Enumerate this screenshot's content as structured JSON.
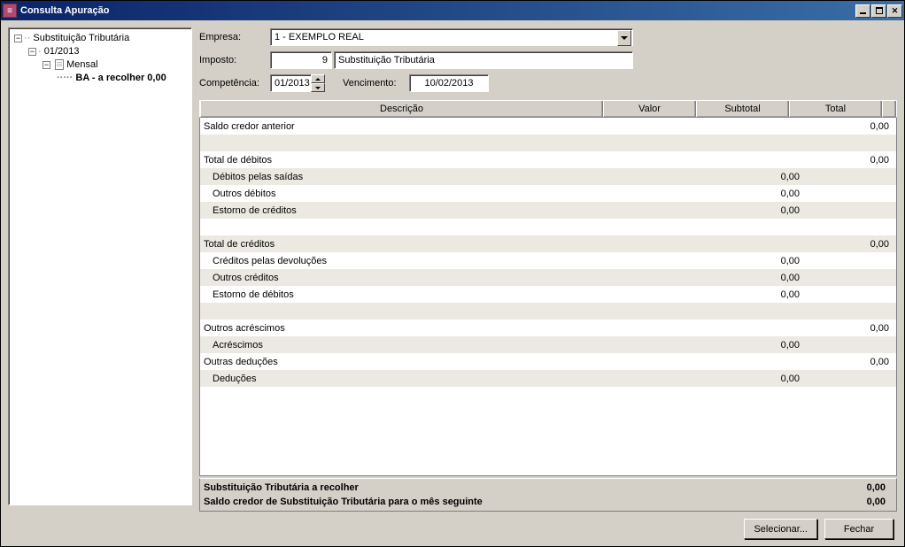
{
  "window": {
    "title": "Consulta Apuração"
  },
  "tree": {
    "root": "Substituição Tributária",
    "period": "01/2013",
    "freq": "Mensal",
    "item": "BA - a recolher 0,00"
  },
  "form": {
    "empresa_label": "Empresa:",
    "empresa_value": "1 - EXEMPLO REAL",
    "imposto_label": "Imposto:",
    "imposto_code": "9",
    "imposto_desc": "Substituição Tributária",
    "competencia_label": "Competência:",
    "competencia_value": "01/2013",
    "vencimento_label": "Vencimento:",
    "vencimento_value": "10/02/2013"
  },
  "grid": {
    "headers": {
      "descricao": "Descrição",
      "valor": "Valor",
      "subtotal": "Subtotal",
      "total": "Total"
    },
    "rows": [
      {
        "desc": "Saldo credor anterior",
        "valor": "",
        "subtotal": "",
        "total": "0,00",
        "indent": false,
        "alt": false
      },
      {
        "desc": "",
        "valor": "",
        "subtotal": "",
        "total": "",
        "indent": false,
        "alt": true
      },
      {
        "desc": "Total de débitos",
        "valor": "",
        "subtotal": "",
        "total": "0,00",
        "indent": false,
        "alt": false
      },
      {
        "desc": "Débitos pelas saídas",
        "valor": "",
        "subtotal": "0,00",
        "total": "",
        "indent": true,
        "alt": true
      },
      {
        "desc": "Outros débitos",
        "valor": "",
        "subtotal": "0,00",
        "total": "",
        "indent": true,
        "alt": false
      },
      {
        "desc": "Estorno de créditos",
        "valor": "",
        "subtotal": "0,00",
        "total": "",
        "indent": true,
        "alt": true
      },
      {
        "desc": "",
        "valor": "",
        "subtotal": "",
        "total": "",
        "indent": false,
        "alt": false
      },
      {
        "desc": "Total de créditos",
        "valor": "",
        "subtotal": "",
        "total": "0,00",
        "indent": false,
        "alt": true
      },
      {
        "desc": "Créditos pelas devoluções",
        "valor": "",
        "subtotal": "0,00",
        "total": "",
        "indent": true,
        "alt": false
      },
      {
        "desc": "Outros créditos",
        "valor": "",
        "subtotal": "0,00",
        "total": "",
        "indent": true,
        "alt": true
      },
      {
        "desc": "Estorno de débitos",
        "valor": "",
        "subtotal": "0,00",
        "total": "",
        "indent": true,
        "alt": false
      },
      {
        "desc": "",
        "valor": "",
        "subtotal": "",
        "total": "",
        "indent": false,
        "alt": true
      },
      {
        "desc": "Outros acréscimos",
        "valor": "",
        "subtotal": "",
        "total": "0,00",
        "indent": false,
        "alt": false
      },
      {
        "desc": "Acréscimos",
        "valor": "",
        "subtotal": "0,00",
        "total": "",
        "indent": true,
        "alt": true
      },
      {
        "desc": "Outras deduções",
        "valor": "",
        "subtotal": "",
        "total": "0,00",
        "indent": false,
        "alt": false
      },
      {
        "desc": "Deduções",
        "valor": "",
        "subtotal": "0,00",
        "total": "",
        "indent": true,
        "alt": true
      }
    ]
  },
  "summary": {
    "line1_desc": "Substituição Tributária a recolher",
    "line1_val": "0,00",
    "line2_desc": "Saldo credor de Substituição Tributária para o mês seguinte",
    "line2_val": "0,00"
  },
  "buttons": {
    "selecionar": "Selecionar...",
    "fechar": "Fechar"
  }
}
